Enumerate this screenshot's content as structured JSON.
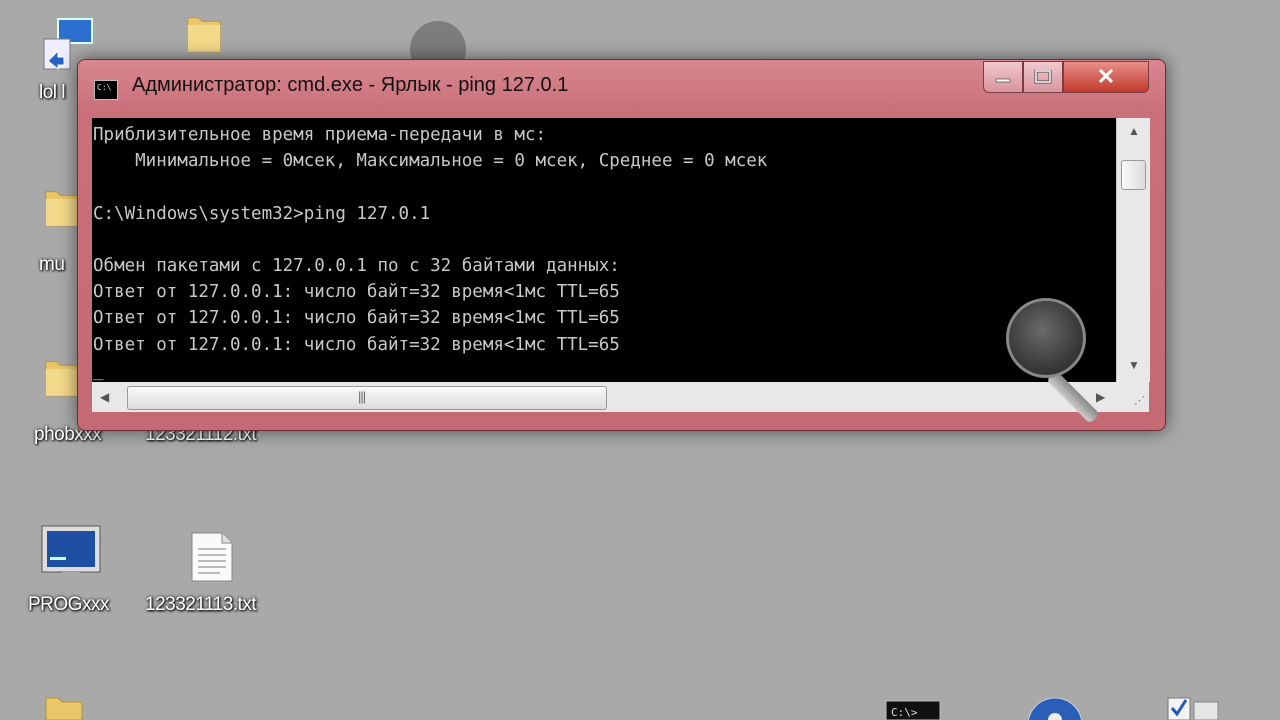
{
  "window": {
    "title": "Администратор: cmd.exe - Ярлык - ping  127.0.1",
    "icon": "cmd-icon",
    "controls": {
      "minimize": "minimize-icon",
      "maximize": "maximize-icon",
      "close": "close-icon",
      "close_glyph": "✕"
    },
    "console_lines": [
      "Приблизительное время приема-передачи в мс:",
      "    Минимальное = 0мсек, Максимальное = 0 мсек, Среднее = 0 мсек",
      "",
      "C:\\Windows\\system32>ping 127.0.1",
      "",
      "Обмен пакетами с 127.0.0.1 по с 32 байтами данных:",
      "Ответ от 127.0.0.1: число байт=32 время<1мс TTL=65",
      "Ответ от 127.0.0.1: число байт=32 время<1мс TTL=65",
      "Ответ от 127.0.0.1: число байт=32 время<1мс TTL=65",
      "_"
    ]
  },
  "desktop": {
    "icons": [
      {
        "label": "lol l",
        "icon": "shortcut-icon"
      },
      {
        "label": "",
        "icon": "folder-icon"
      },
      {
        "label": "mu",
        "icon": "folder-icon"
      },
      {
        "label": "phobxxx",
        "icon": "folder-icon"
      },
      {
        "label": "123321112.txt",
        "icon": "text-file-icon"
      },
      {
        "label": "PROGxxx",
        "icon": "program-icon"
      },
      {
        "label": "123321113.txt",
        "icon": "text-file-icon"
      }
    ]
  },
  "colors": {
    "desktop": "#a9a9a9",
    "window_frame": "#c46a74",
    "console_bg": "#000000",
    "console_text": "#c8c8c8"
  }
}
